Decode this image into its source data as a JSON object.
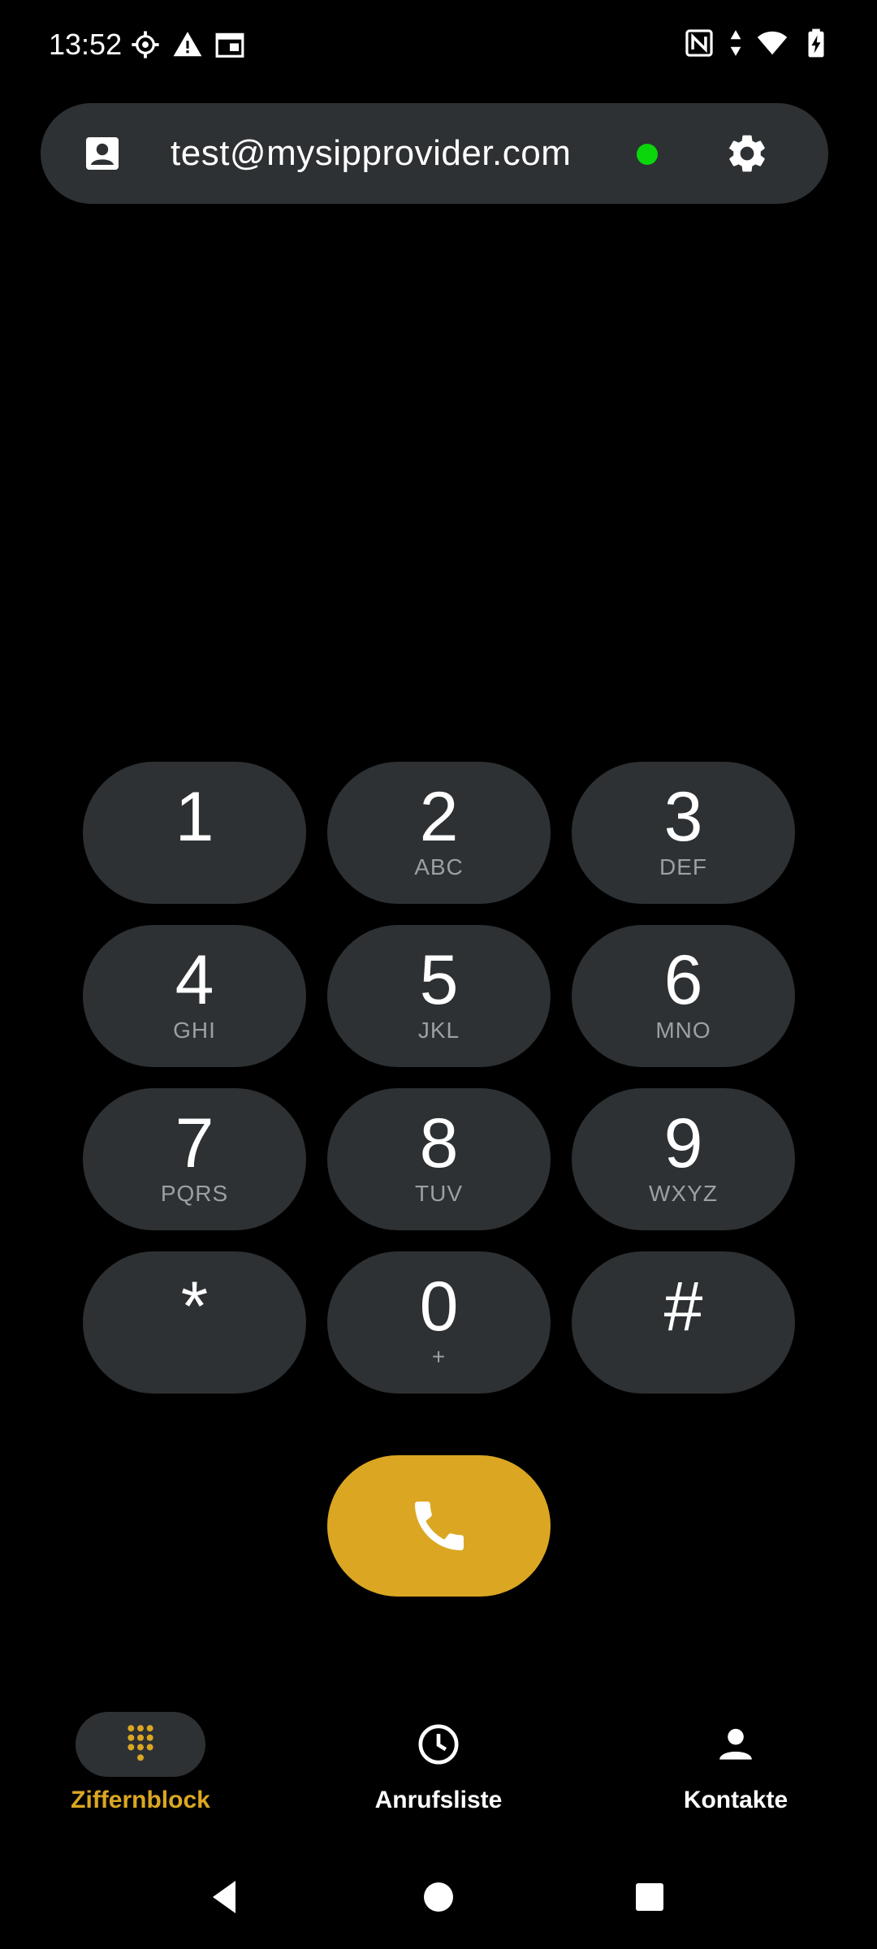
{
  "status_bar": {
    "time": "13:52",
    "left_icons": [
      "settings-gear-icon",
      "warning-icon",
      "calendar-icon"
    ],
    "right_icons": [
      "nfc-icon",
      "data-arrows-icon",
      "wifi-icon",
      "battery-charging-icon"
    ]
  },
  "account": {
    "name": "test@mysipprovider.com",
    "status_color": "#0bd60b"
  },
  "keypad": {
    "keys": [
      {
        "digit": "1",
        "letters": ""
      },
      {
        "digit": "2",
        "letters": "ABC"
      },
      {
        "digit": "3",
        "letters": "DEF"
      },
      {
        "digit": "4",
        "letters": "GHI"
      },
      {
        "digit": "5",
        "letters": "JKL"
      },
      {
        "digit": "6",
        "letters": "MNO"
      },
      {
        "digit": "7",
        "letters": "PQRS"
      },
      {
        "digit": "8",
        "letters": "TUV"
      },
      {
        "digit": "9",
        "letters": "WXYZ"
      },
      {
        "digit": "*",
        "letters": ""
      },
      {
        "digit": "0",
        "letters": "+"
      },
      {
        "digit": "#",
        "letters": ""
      }
    ]
  },
  "call_button": {
    "color": "#dba722"
  },
  "bottom_nav": {
    "items": [
      {
        "label": "Ziffernblock",
        "icon": "dialpad-icon",
        "active": true
      },
      {
        "label": "Anrufsliste",
        "icon": "clock-icon",
        "active": false
      },
      {
        "label": "Kontakte",
        "icon": "person-icon",
        "active": false
      }
    ]
  },
  "theme": {
    "accent": "#dba722",
    "surface": "#2d3133",
    "background": "#000000"
  }
}
